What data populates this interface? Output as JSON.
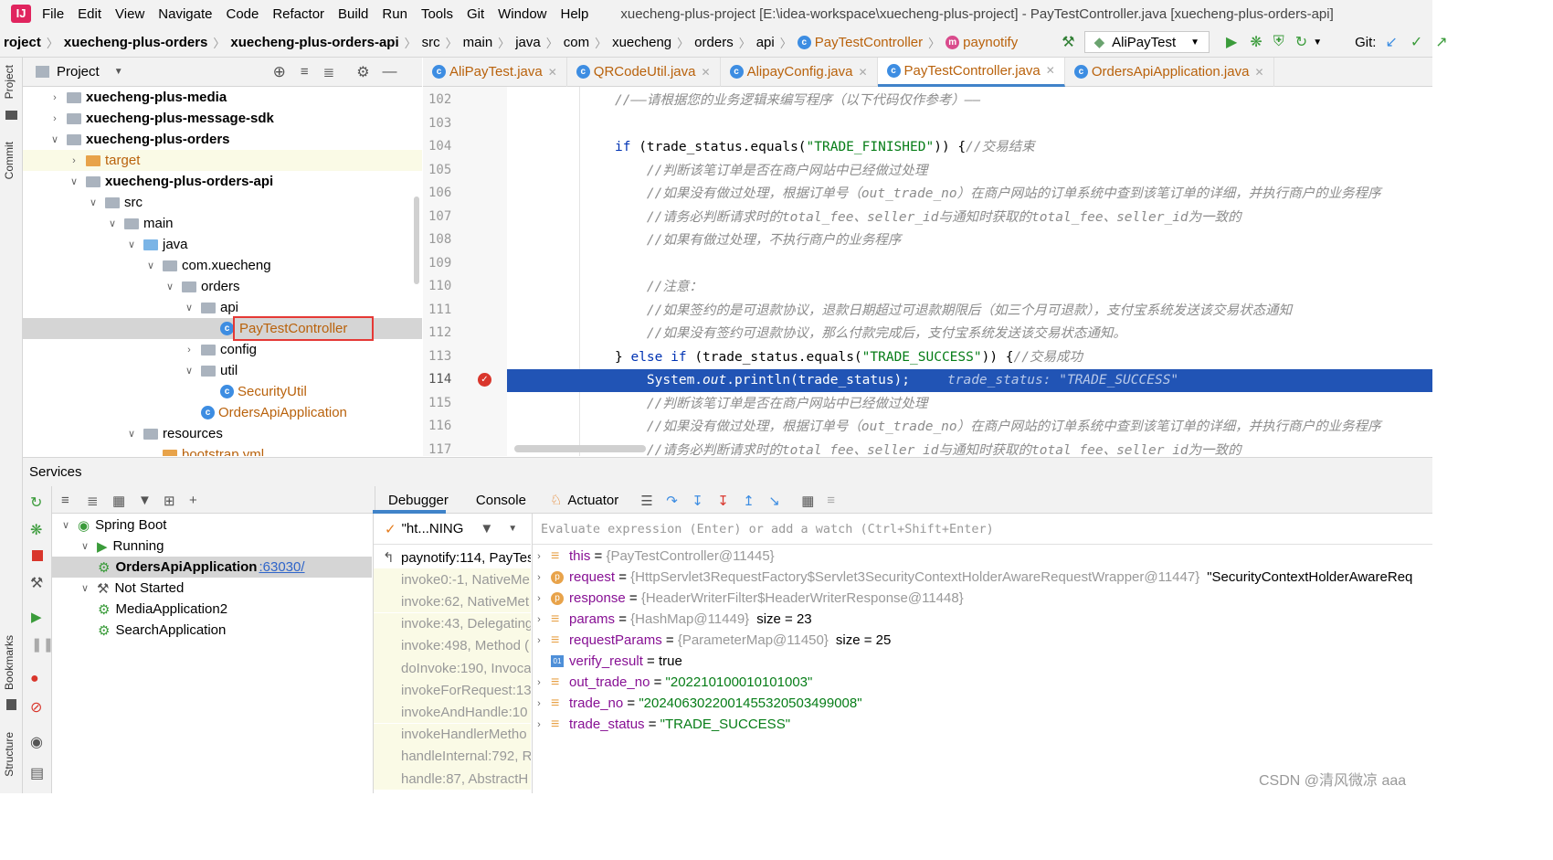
{
  "menubar": {
    "items": [
      "File",
      "Edit",
      "View",
      "Navigate",
      "Code",
      "Refactor",
      "Build",
      "Run",
      "Tools",
      "Git",
      "Window",
      "Help"
    ],
    "window_title": "xuecheng-plus-project [E:\\idea-workspace\\xuecheng-plus-project] - PayTestController.java [xuecheng-plus-orders-api]"
  },
  "navbar": {
    "crumbs": [
      "roject",
      "xuecheng-plus-orders",
      "xuecheng-plus-orders-api",
      "src",
      "main",
      "java",
      "com",
      "xuecheng",
      "orders",
      "api",
      "PayTestController",
      "paynotify"
    ],
    "run_config": "AliPayTest",
    "git_label": "Git:"
  },
  "project": {
    "title": "Project",
    "tree": [
      {
        "label": "xuecheng-plus-media",
        "indent": 0,
        "arrow": "right",
        "bold": true
      },
      {
        "label": "xuecheng-plus-message-sdk",
        "indent": 0,
        "arrow": "right",
        "bold": true
      },
      {
        "label": "xuecheng-plus-orders",
        "indent": 0,
        "arrow": "down",
        "bold": true
      },
      {
        "label": "target",
        "indent": 1,
        "arrow": "right",
        "bold": false
      },
      {
        "label": "xuecheng-plus-orders-api",
        "indent": 1,
        "arrow": "down",
        "bold": true
      },
      {
        "label": "src",
        "indent": 2,
        "arrow": "down",
        "bold": false
      },
      {
        "label": "main",
        "indent": 3,
        "arrow": "down",
        "bold": false
      },
      {
        "label": "java",
        "indent": 4,
        "arrow": "down",
        "bold": false
      },
      {
        "label": "com.xuecheng",
        "indent": 5,
        "arrow": "down",
        "bold": false
      },
      {
        "label": "orders",
        "indent": 6,
        "arrow": "down",
        "bold": false
      },
      {
        "label": "api",
        "indent": 7,
        "arrow": "down",
        "bold": false
      },
      {
        "label": "PayTestController",
        "indent": 8,
        "arrow": "none",
        "bold": false
      },
      {
        "label": "config",
        "indent": 7,
        "arrow": "right",
        "bold": false
      },
      {
        "label": "util",
        "indent": 7,
        "arrow": "down",
        "bold": false
      },
      {
        "label": "SecurityUtil",
        "indent": 8,
        "arrow": "none",
        "bold": false
      },
      {
        "label": "OrdersApiApplication",
        "indent": 7,
        "arrow": "none",
        "bold": false
      },
      {
        "label": "resources",
        "indent": 4,
        "arrow": "down",
        "bold": false
      },
      {
        "label": "bootstrap.yml",
        "indent": 5,
        "arrow": "none",
        "bold": false
      }
    ]
  },
  "editor": {
    "tabs": [
      "AliPayTest.java",
      "QRCodeUtil.java",
      "AlipayConfig.java",
      "PayTestController.java",
      "OrdersApiApplication.java"
    ],
    "active_tab": "PayTestController.java",
    "line_numbers": [
      "102",
      "103",
      "104",
      "105",
      "106",
      "107",
      "108",
      "109",
      "110",
      "111",
      "112",
      "113",
      "114",
      "115",
      "116",
      "117"
    ],
    "lines": [
      "//——请根据您的业务逻辑来编写程序（以下代码仅作参考）——",
      "",
      "if (trade_status.equals(\"TRADE_FINISHED\")) {//交易结束",
      "    //判断该笔订单是否在商户网站中已经做过处理",
      "    //如果没有做过处理，根据订单号（out_trade_no）在商户网站的订单系统中查到该笔订单的详细，并执行商户的业务程序",
      "    //请务必判断请求时的total_fee、seller_id与通知时获取的total_fee、seller_id为一致的",
      "    //如果有做过处理，不执行商户的业务程序",
      "",
      "    //注意：",
      "    //如果签约的是可退款协议，退款日期超过可退款期限后（如三个月可退款），支付宝系统发送该交易状态通知",
      "    //如果没有签约可退款协议，那么付款完成后，支付宝系统发送该交易状态通知。",
      "} else if (trade_status.equals(\"TRADE_SUCCESS\")) {//交易成功",
      "    System.out.println(trade_status);",
      "    //判断该笔订单是否在商户网站中已经做过处理",
      "    //如果没有做过处理，根据订单号（out_trade_no）在商户网站的订单系统中查到该笔订单的详细，并执行商户的业务程序",
      "    //请务必判断请求时的total_fee、seller_id与通知时获取的total_fee、seller_id为一致的"
    ],
    "inline_value": "trade_status: \"TRADE_SUCCESS\""
  },
  "services": {
    "title": "Services",
    "tree": [
      {
        "label": "Spring Boot",
        "indent": 0
      },
      {
        "label": "Running",
        "indent": 1
      },
      {
        "label": "OrdersApiApplication",
        "indent": 2,
        "port": ":63030/"
      },
      {
        "label": "Not Started",
        "indent": 1
      },
      {
        "label": "MediaApplication2",
        "indent": 2
      },
      {
        "label": "SearchApplication",
        "indent": 2
      }
    ],
    "debug_tabs": [
      "Debugger",
      "Console",
      "Actuator"
    ],
    "thread": "\"ht...NING",
    "frames": [
      "paynotify:114, PayTes",
      "invoke0:-1, NativeMe",
      "invoke:62, NativeMet",
      "invoke:43, Delegating",
      "invoke:498, Method (",
      "doInvoke:190, Invoca",
      "invokeForRequest:13",
      "invokeAndHandle:10",
      "invokeHandlerMetho",
      "handleInternal:792, R",
      "handle:87, AbstractH"
    ],
    "eval_placeholder": "Evaluate expression (Enter) or add a watch (Ctrl+Shift+Enter)",
    "variables": [
      {
        "name": "this",
        "value": "{PayTestController@11445}",
        "extra": "",
        "kind": "obj",
        "expand": true
      },
      {
        "name": "request",
        "value": "{HttpServlet3RequestFactory$Servlet3SecurityContextHolderAwareRequestWrapper@11447}",
        "extra": "\"SecurityContextHolderAwareReq",
        "kind": "param",
        "expand": true
      },
      {
        "name": "response",
        "value": "{HeaderWriterFilter$HeaderWriterResponse@11448}",
        "extra": "",
        "kind": "param",
        "expand": true
      },
      {
        "name": "params",
        "value": "{HashMap@11449}",
        "extra": "size = 23",
        "kind": "obj",
        "expand": true
      },
      {
        "name": "requestParams",
        "value": "{ParameterMap@11450}",
        "extra": "size = 25",
        "kind": "obj",
        "expand": true
      },
      {
        "name": "verify_result",
        "value": "true",
        "extra": "",
        "kind": "bool",
        "expand": false
      },
      {
        "name": "out_trade_no",
        "value": "\"202210100010101003\"",
        "extra": "",
        "kind": "obj",
        "expand": true
      },
      {
        "name": "trade_no",
        "value": "\"2024063022001455320503499008\"",
        "extra": "",
        "kind": "obj",
        "expand": true
      },
      {
        "name": "trade_status",
        "value": "\"TRADE_SUCCESS\"",
        "extra": "",
        "kind": "obj",
        "expand": true
      }
    ]
  },
  "side_tabs": {
    "project": "Project",
    "commit": "Commit",
    "bookmarks": "Bookmarks",
    "structure": "Structure"
  },
  "watermark": "CSDN @清风微凉 aaa",
  "colors": {
    "accent": "#2154b5",
    "selection_box": "#e53935",
    "string": "#067d17",
    "keyword": "#0033b3"
  }
}
